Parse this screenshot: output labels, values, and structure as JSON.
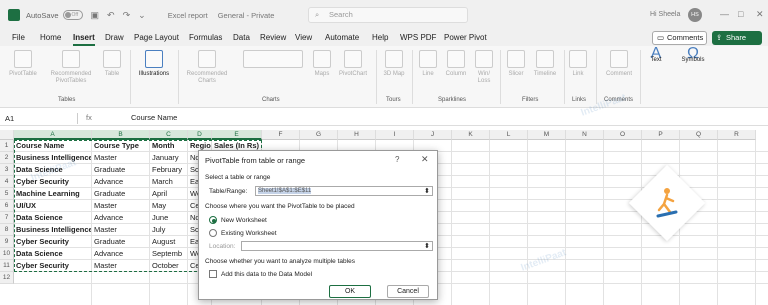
{
  "titlebar": {
    "autosave": "AutoSave",
    "toggle": "Off",
    "filename": "Excel report",
    "sensitivity": "General - Private",
    "search_placeholder": "Search",
    "user": "Hi Sheela",
    "avatar": "HS"
  },
  "menu": {
    "items": [
      "File",
      "Home",
      "Insert",
      "Draw",
      "Page Layout",
      "Formulas",
      "Data",
      "Review",
      "View",
      "Automate",
      "Help",
      "WPS PDF",
      "Power Pivot"
    ],
    "comments": "Comments",
    "share": "Share"
  },
  "ribbon": {
    "buttons": {
      "pivottable": "PivotTable",
      "recommended_pivot": "Recommended PivotTables",
      "table": "Table",
      "illustrations": "Illustrations",
      "recommended_charts": "Recommended Charts",
      "maps": "Maps",
      "pivotchart": "PivotChart",
      "map3d": "3D Map",
      "line": "Line",
      "column": "Column",
      "winloss": "Win/ Loss",
      "slicer": "Slicer",
      "timeline": "Timeline",
      "link": "Link",
      "comment": "Comment",
      "text": "Text",
      "symbols": "Symbols"
    },
    "groups": {
      "tables": "Tables",
      "charts": "Charts",
      "tours": "Tours",
      "sparklines": "Sparklines",
      "filters": "Filters",
      "links": "Links",
      "comments": "Comments"
    }
  },
  "formula_bar": {
    "namebox": "A1",
    "fx": "fx",
    "content": "Course Name"
  },
  "sheet": {
    "columns": [
      "A",
      "B",
      "C",
      "D",
      "E",
      "F",
      "G",
      "H",
      "I",
      "J",
      "K",
      "L",
      "M",
      "N",
      "O",
      "P",
      "Q",
      "R"
    ],
    "rows": [
      "1",
      "2",
      "3",
      "4",
      "5",
      "6",
      "7",
      "8",
      "9",
      "10",
      "11",
      "12"
    ],
    "data": [
      [
        "Course Name",
        "Course Type",
        "Month",
        "Region",
        "Sales (In Rs)"
      ],
      [
        "Business Intelligence",
        "Master",
        "January",
        "No",
        ""
      ],
      [
        "Data Science",
        "Graduate",
        "February",
        "So",
        ""
      ],
      [
        "Cyber Security",
        "Advance",
        "March",
        "Ea",
        ""
      ],
      [
        "Machine Learning",
        "Graduate",
        "April",
        "We",
        ""
      ],
      [
        "UI/UX",
        "Master",
        "May",
        "Ce",
        ""
      ],
      [
        "Data Science",
        "Advance",
        "June",
        "No",
        ""
      ],
      [
        "Business Intelligence",
        "Master",
        "July",
        "So",
        ""
      ],
      [
        "Cyber Security",
        "Graduate",
        "August",
        "Ea",
        ""
      ],
      [
        "Data Science",
        "Advance",
        "Septemb",
        "We",
        ""
      ],
      [
        "Cyber Security",
        "Master",
        "October",
        "Ce",
        ""
      ]
    ]
  },
  "dialog": {
    "title": "PivotTable from table or range",
    "help": "?",
    "close": "✕",
    "select_label": "Select a table or range",
    "table_range_label": "Table/Range:",
    "table_range_value": "Sheet1!$A$1:$E$11",
    "placement_label": "Choose where you want the PivotTable to be placed",
    "new_worksheet": "New Worksheet",
    "existing_worksheet": "Existing Worksheet",
    "location_label": "Location:",
    "multiple_tables_label": "Choose whether you want to analyze multiple tables",
    "data_model": "Add this data to the Data Model",
    "ok": "OK",
    "cancel": "Cancel"
  },
  "watermark": "IntelliPaat"
}
